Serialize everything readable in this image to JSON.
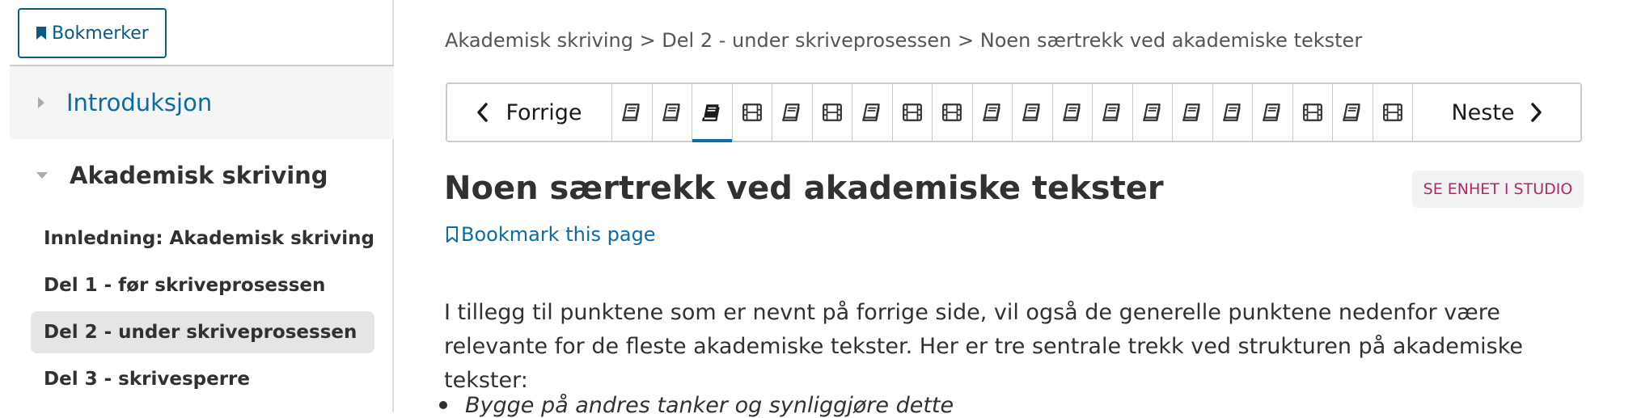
{
  "sidebar": {
    "bookmarks_button": "Bokmerker",
    "sections": [
      {
        "label": "Introduksjon",
        "expanded": false
      },
      {
        "label": "Akademisk skriving",
        "expanded": true
      }
    ],
    "subsections": [
      {
        "label": "Innledning: Akademisk skriving",
        "active": false
      },
      {
        "label": "Del 1 - før skriveprosessen",
        "active": false
      },
      {
        "label": "Del 2 - under skriveprosessen",
        "active": true
      },
      {
        "label": "Del 3 - skrivesperre",
        "active": false
      }
    ]
  },
  "breadcrumb": "Akademisk skriving > Del 2 - under skriveprosessen > Noen særtrekk ved akademiske tekster",
  "sequence": {
    "prev_label": "Forrige",
    "next_label": "Neste",
    "active_index": 2,
    "items": [
      "book-icon",
      "book-icon",
      "book-icon",
      "video-icon",
      "book-icon",
      "video-icon",
      "book-icon",
      "video-icon",
      "video-icon",
      "book-icon",
      "book-icon",
      "book-icon",
      "book-icon",
      "book-icon",
      "book-icon",
      "book-icon",
      "book-icon",
      "video-icon",
      "book-icon",
      "video-icon"
    ]
  },
  "unit": {
    "title": "Noen særtrekk ved akademiske tekster",
    "studio_button": "SE ENHET I STUDIO",
    "bookmark_link": "Bookmark this page",
    "paragraph": "I tillegg til punktene som er nevnt på forrige side, vil også de generelle punktene nedenfor være relevante for de fleste akademiske tekster. Her er tre sentrale trekk ved strukturen på akademiske tekster:",
    "bullets": [
      "Bygge på andres tanker og synliggjøre dette"
    ]
  },
  "colors": {
    "link": "#0a6ca3",
    "studio_text": "#b2286c",
    "active_bar": "#0a6ca3"
  }
}
